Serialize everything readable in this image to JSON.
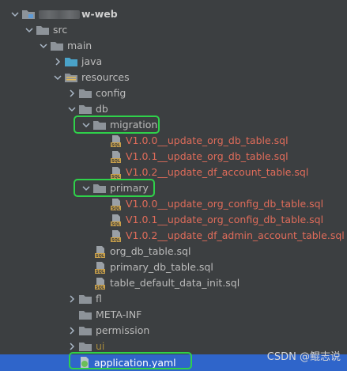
{
  "tree": {
    "project_suffix": "w-web",
    "src": "src",
    "main": "main",
    "java": "java",
    "resources": "resources",
    "config": "config",
    "db": "db",
    "migration": "migration",
    "migration_files": [
      "V1.0.0__update_org_db_table.sql",
      "V1.0.1__update_org_db_table.sql",
      "V1.0.2__update_df_account_table.sql"
    ],
    "primary": "primary",
    "primary_files": [
      "V1.0.0__update_org_config_db_table.sql",
      "V1.0.1__update_org_config_db_table.sql",
      "V1.0.2__update_df_admin_account_table.sql"
    ],
    "db_files": [
      "org_db_table.sql",
      "primary_db_table.sql",
      "table_default_data_init.sql"
    ],
    "fl": "fl",
    "meta_inf": "META-INF",
    "permission": "permission",
    "ui": "ui",
    "application_yaml": "application.yaml"
  },
  "watermark": "CSDN @鲲志说",
  "colors": {
    "background": "#3c3f41",
    "selection": "#2f65ca",
    "highlight_box": "#2fd14a",
    "changed_file": "#e06c5a",
    "folder": "#8d9399",
    "java_folder": "#4aa3c9"
  }
}
